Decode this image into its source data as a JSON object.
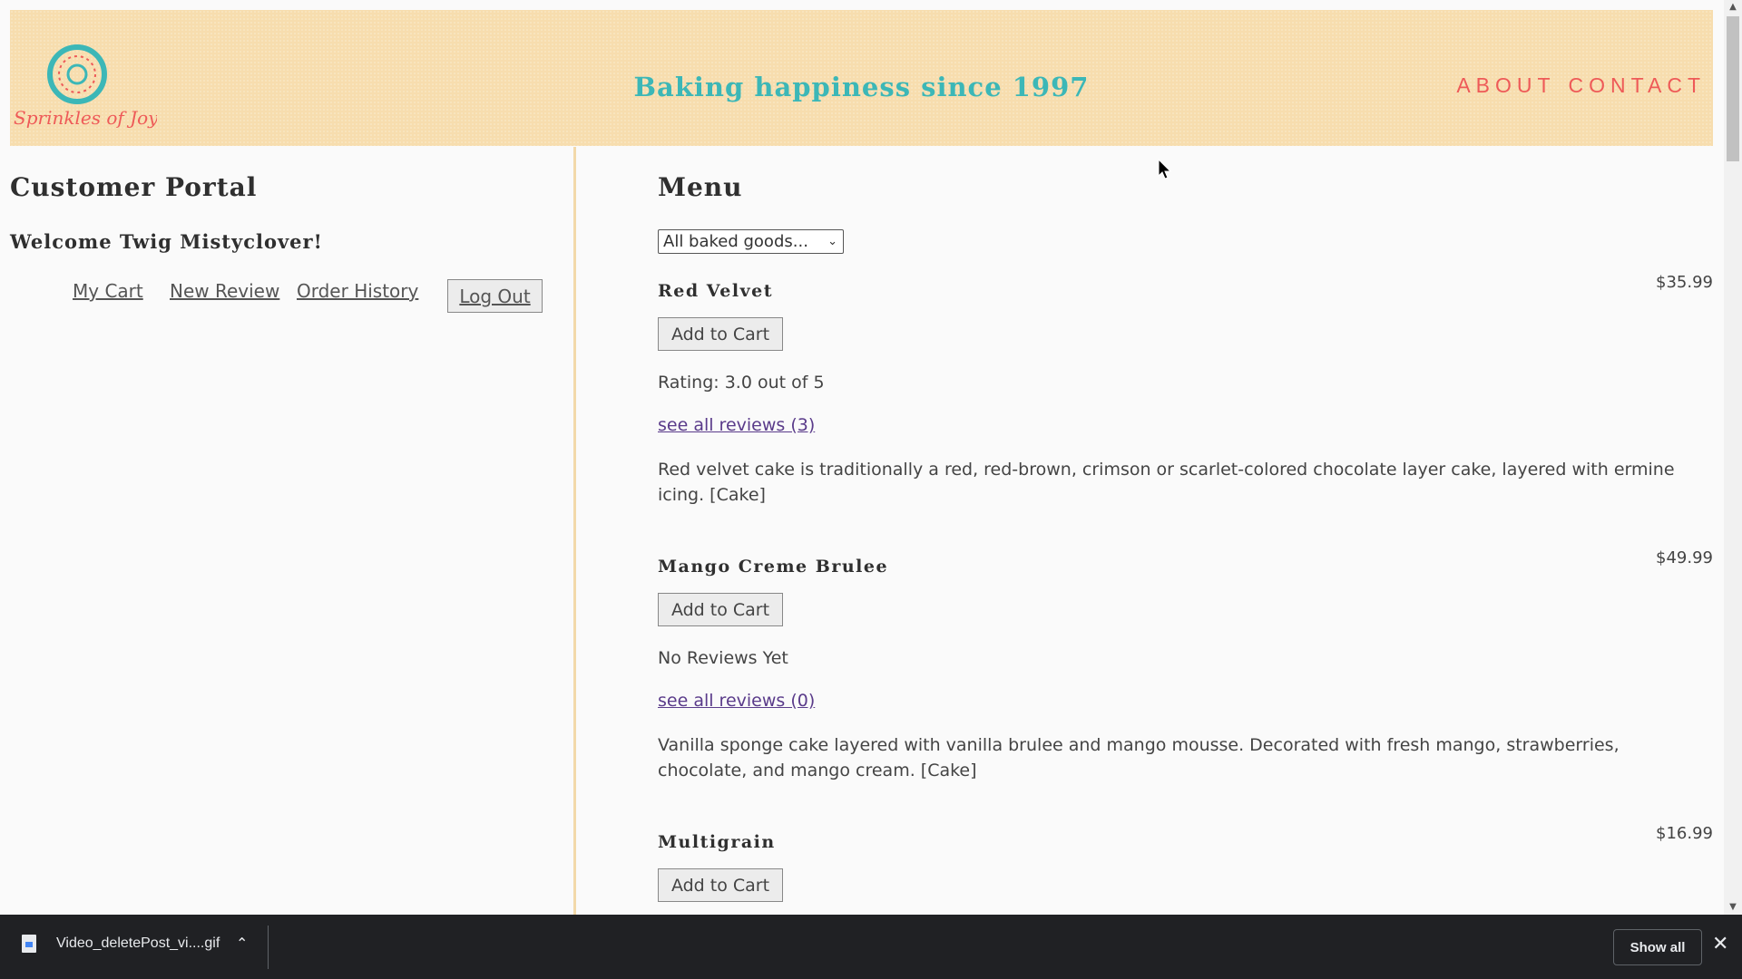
{
  "header": {
    "logo_text": "Sprinkles of Joy",
    "tagline": "Baking happiness since 1997",
    "nav": [
      "ABOUT",
      "CONTACT"
    ]
  },
  "portal": {
    "title": "Customer Portal",
    "welcome": "Welcome Twig Mistyclover!",
    "links": [
      "My Cart",
      "New Review",
      "Order History"
    ],
    "logout_label": "Log Out"
  },
  "menu": {
    "title": "Menu",
    "filter_selected": "All baked goods...",
    "add_label": "Add to Cart",
    "items": [
      {
        "name": "Red Velvet",
        "price": "$35.99",
        "rating": "Rating: 3.0 out of 5",
        "reviews_link": "see all reviews (3)",
        "description": "Red velvet cake is traditionally a red, red-brown, crimson or scarlet-colored chocolate layer cake, layered with ermine icing. [Cake]"
      },
      {
        "name": "Mango Creme Brulee",
        "price": "$49.99",
        "rating": "No Reviews Yet",
        "reviews_link": "see all reviews (0)",
        "description": "Vanilla sponge cake layered with vanilla brulee and mango mousse. Decorated with fresh mango, strawberries, chocolate, and mango cream. [Cake]"
      },
      {
        "name": "Multigrain",
        "price": "$16.99"
      }
    ]
  },
  "downloads": {
    "file_name": "Video_deletePost_vi....gif",
    "show_all_label": "Show all"
  },
  "colors": {
    "header_bg": "#f7ddae",
    "tagline": "#3cb7b7",
    "nav": "#ee5a58",
    "divider": "#f2d9aa"
  }
}
